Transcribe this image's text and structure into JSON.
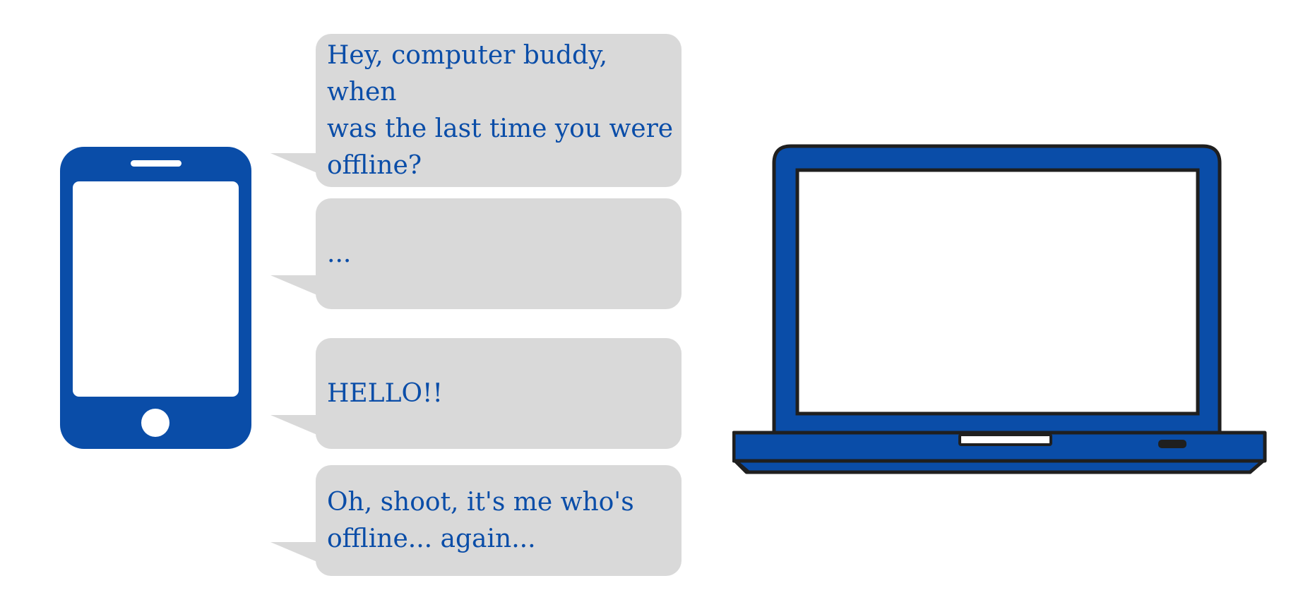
{
  "colors": {
    "device_blue": "#0a4da8",
    "bubble_gray": "#d9d9d9",
    "outline": "#1f1f1f",
    "screen": "#ffffff"
  },
  "icons": {
    "phone": "smartphone-icon",
    "laptop": "laptop-icon"
  },
  "messages": [
    {
      "text": "Hey, computer buddy, when\nwas the last time you were\noffline?"
    },
    {
      "text": "..."
    },
    {
      "text": "HELLO!!"
    },
    {
      "text": "Oh, shoot, it's me who's\noffline... again..."
    }
  ]
}
